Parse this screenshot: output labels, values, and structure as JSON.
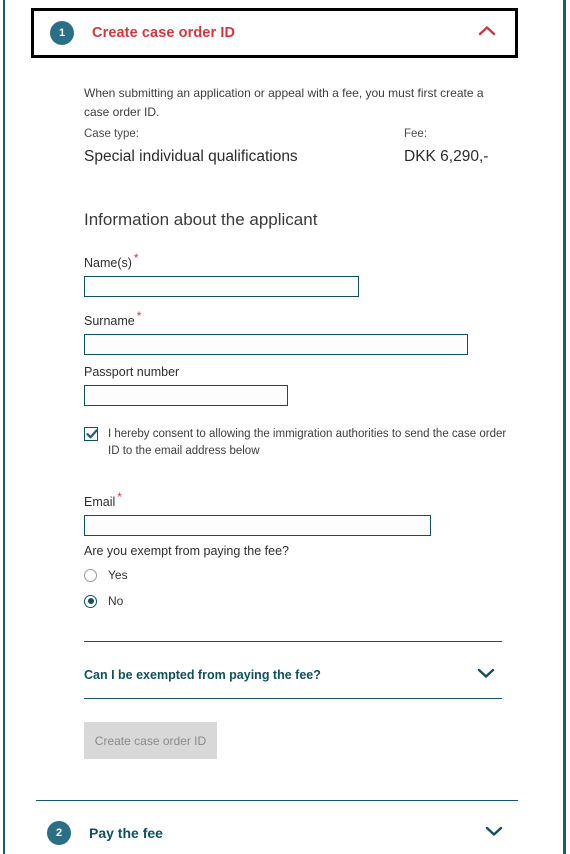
{
  "colors": {
    "accent_teal": "#10505f",
    "badge_teal": "#2a6f87",
    "title_red": "#d2373f",
    "disabled_button_bg": "#d8d8d8"
  },
  "section1": {
    "step_number": "1",
    "title": "Create case order ID",
    "expanded": true,
    "toggle_icon": "chevron-up-icon",
    "intro": "When submitting an application or appeal with a fee, you must first create a case order ID.",
    "case_type_label": "Case type:",
    "case_type_value": "Special individual qualifications",
    "fee_label": "Fee:",
    "fee_value": "DKK 6,290,-",
    "form_heading": "Information about the applicant",
    "fields": [
      {
        "label": "Name(s)",
        "required": true,
        "value": "",
        "placeholder": ""
      },
      {
        "label": "Surname",
        "required": true,
        "value": "",
        "placeholder": ""
      },
      {
        "label": "Passport number",
        "required": false,
        "value": "",
        "placeholder": ""
      }
    ],
    "consent": {
      "checked": true,
      "icon": "checkmark-icon",
      "text": "I hereby consent to allowing the immigration authorities to send the case order ID to the email address below"
    },
    "email_field": {
      "label": "Email",
      "required": true,
      "value": "",
      "placeholder": ""
    },
    "exempt_question": {
      "legend": "Are you exempt from paying the fee?",
      "options": [
        {
          "label": "Yes",
          "selected": false
        },
        {
          "label": "No",
          "selected": true
        }
      ]
    },
    "faq": {
      "title": "Can I be exempted from paying the fee?",
      "expanded": false,
      "toggle_icon": "chevron-down-icon"
    },
    "submit_button": {
      "label": "Create case order ID",
      "disabled": true
    }
  },
  "section2": {
    "step_number": "2",
    "title": "Pay the fee",
    "expanded": false,
    "toggle_icon": "chevron-down-icon"
  }
}
